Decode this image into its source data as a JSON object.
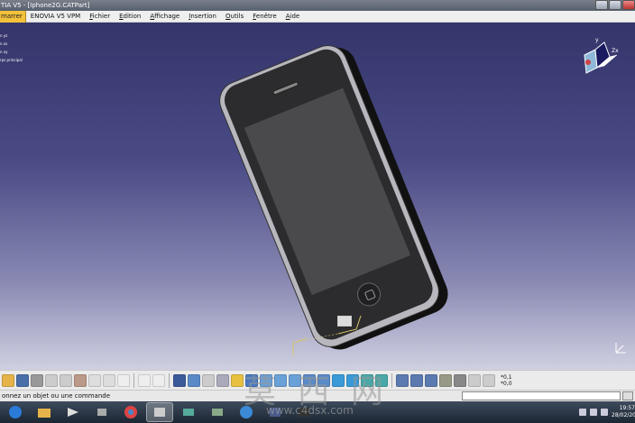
{
  "titlebar": {
    "title": "TIA V5 - [Iphone2G.CATPart]"
  },
  "menu": {
    "start": "marrer",
    "items": [
      {
        "text": "ENOVIA V5 VPM",
        "under": "",
        "rest": "ENOVIA V5 VPM"
      },
      {
        "text": "Fichier",
        "under": "F",
        "rest": "ichier"
      },
      {
        "text": "Edition",
        "under": "E",
        "rest": "dition"
      },
      {
        "text": "Affichage",
        "under": "A",
        "rest": "ffichage"
      },
      {
        "text": "Insertion",
        "under": "I",
        "rest": "nsertion"
      },
      {
        "text": "Outils",
        "under": "O",
        "rest": "utils"
      },
      {
        "text": "Fenêtre",
        "under": "F",
        "rest": "enêtre"
      },
      {
        "text": "Aide",
        "under": "A",
        "rest": "ide"
      }
    ]
  },
  "tree": {
    "lines": [
      "n yz",
      "n zx",
      "n xy",
      "rps principal"
    ]
  },
  "compass": {
    "label_y": "y",
    "label_zx": "Zx"
  },
  "toolbar": {
    "readout_top": "*0,1",
    "readout_bottom": "*0,0"
  },
  "status": {
    "message": "onnez un objet ou une commande",
    "command_value": ""
  },
  "taskbar": {
    "clock_time": "19:57",
    "clock_date": "28/02/20",
    "active_index": 5
  },
  "watermark": {
    "text": "莫 西 网",
    "url": "www.c4dsx.com"
  },
  "colors": {
    "menu_start_bg": "#f3c13a",
    "viewport_top": "#35356b",
    "viewport_bottom": "#d0d0e2",
    "axis_yellow": "#d8c86a"
  },
  "icons": {
    "toolbar": [
      "folder-icon",
      "save-icon",
      "print-icon",
      "cut-icon",
      "copy-icon",
      "paste-icon",
      "undo-icon",
      "redo-icon",
      "help-icon",
      "formula-icon",
      "comment-icon",
      "grid-icon",
      "snap-icon",
      "tree-icon",
      "measure-icon",
      "fit-all-icon",
      "pan-icon",
      "rotate-icon",
      "zoom-in-icon",
      "zoom-out-icon",
      "normal-view-icon",
      "iso-view-icon",
      "cube-view-icon",
      "shading-icon",
      "hide-show-icon",
      "swap-icon",
      "measure-between-icon",
      "measure-item-icon",
      "inertia-icon",
      "update-icon",
      "catalog-icon",
      "knowledge-icon"
    ],
    "taskbar": [
      "start-orb-icon",
      "folder-icon",
      "media-icon",
      "tools-icon",
      "chrome-icon",
      "window-icon",
      "network-icon",
      "vpn-icon",
      "ie-icon",
      "catia-icon",
      "app-icon"
    ]
  }
}
